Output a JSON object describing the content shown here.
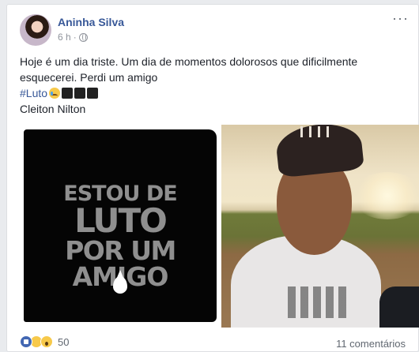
{
  "post": {
    "author": "Aninha Silva",
    "time": "6 h",
    "text_line1": "Hoje é um dia triste. Um dia de momentos dolorosos que dificilmente",
    "text_line2": "esquecerei. Perdi um amigo",
    "hashtag": "#Luto",
    "text_line4": "Cleiton Nilton",
    "privacy_icon": "globe-icon",
    "more_label": "···"
  },
  "image_left": {
    "line1": "ESTOU DE",
    "line2": "LUTO",
    "line3": "POR UM",
    "line4": "AMIGO"
  },
  "footer": {
    "reaction_count": "50",
    "comments": "11 comentários"
  },
  "colors": {
    "name_link": "#385898",
    "meta": "#90949c",
    "like": "#4267b2"
  }
}
